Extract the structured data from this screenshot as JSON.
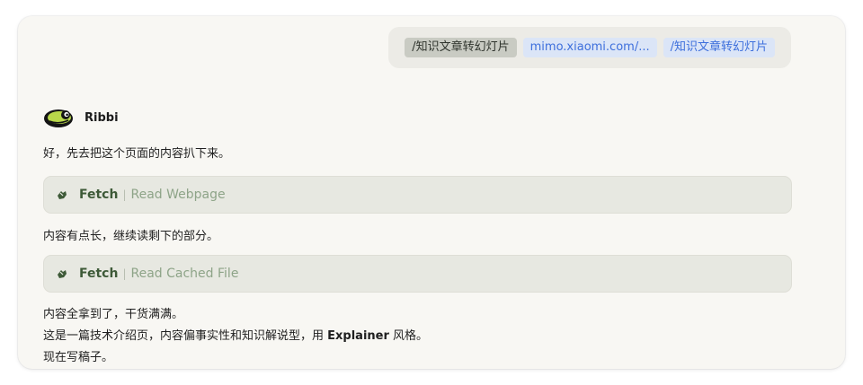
{
  "user_message": {
    "chips": [
      {
        "text": "/知识文章转幻灯片",
        "kind": "command"
      },
      {
        "text": "mimo.xiaomi.com/...",
        "kind": "link"
      },
      {
        "text": "/知识文章转幻灯片",
        "kind": "link"
      }
    ]
  },
  "assistant": {
    "name": "Ribbi",
    "avatar_icon": "frog-avatar-icon",
    "messages": [
      "好，先去把这个页面的内容扒下来。",
      "内容有点长，继续读剩下的部分。",
      "内容全拿到了，干货满满。",
      "现在写稿子。"
    ],
    "message_4_prefix": "这是一篇技术介绍页，内容偏事实性和知识解说型，用 ",
    "message_4_keyword": "Explainer",
    "message_4_suffix": " 风格。",
    "tools": [
      {
        "name": "Fetch",
        "separator": "|",
        "detail": "Read Webpage",
        "icon": "fetch-hand-icon"
      },
      {
        "name": "Fetch",
        "separator": "|",
        "detail": "Read Cached File",
        "icon": "fetch-hand-icon"
      }
    ]
  },
  "colors": {
    "window_bg": "#f8f7f3",
    "bubble_bg": "#ecebe6",
    "command_chip_bg": "#c9cbc3",
    "link_chip_bg": "#dbe5f7",
    "link_text": "#3d6fdc",
    "tool_bg": "#e7e8e1",
    "tool_name": "#3e5a38",
    "tool_detail": "#8ea488",
    "avatar_green": "#b9d84a"
  }
}
